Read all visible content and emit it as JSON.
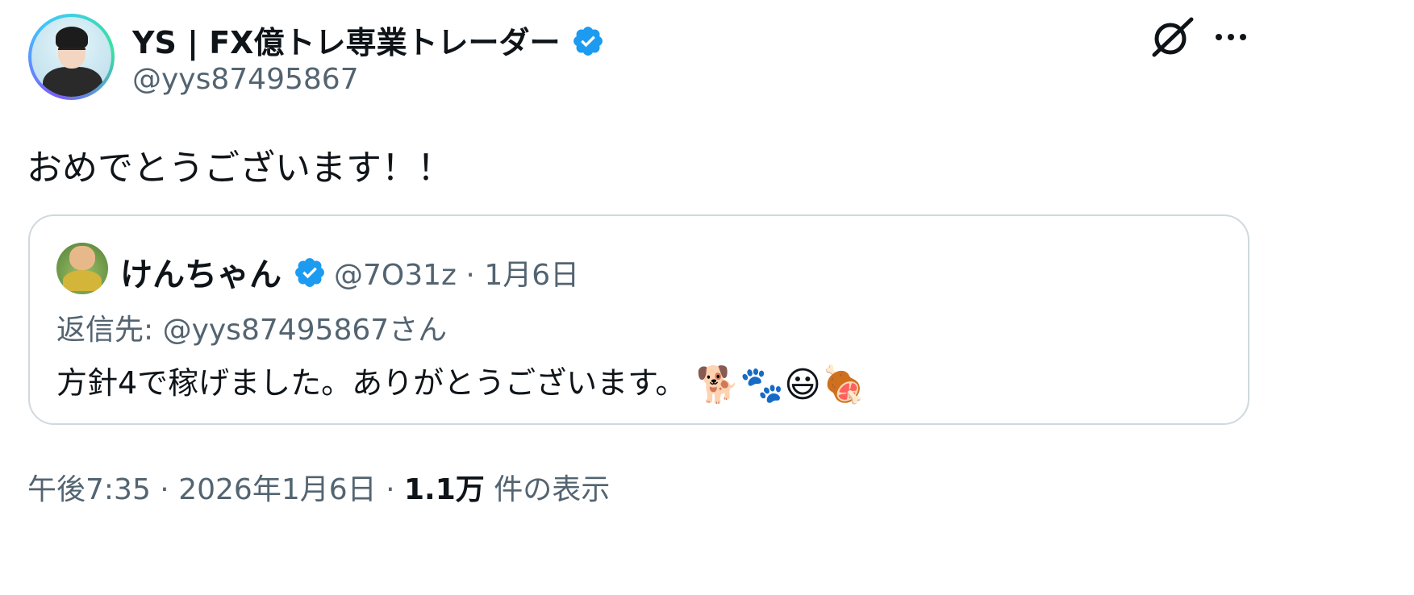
{
  "author": {
    "display_name": "YS | FX億トレ専業トレーダー",
    "handle": "@yys87495867",
    "verified": true,
    "avatar_icon": "profile-avatar"
  },
  "icons": {
    "verified": "verified-badge-icon",
    "grok": "grok-icon",
    "more": "more-options-icon"
  },
  "tweet": {
    "text": "おめでとうございます！！"
  },
  "quote": {
    "display_name": "けんちゃん",
    "verified": true,
    "handle": "@7O31z",
    "separator": "·",
    "date": "1月6日",
    "reply_to": "返信先: @yys87495867さん",
    "text": "方針4で稼げました。ありがとうございます。",
    "emojis": [
      "🐕",
      "🐾",
      "😃",
      "🍖"
    ]
  },
  "meta": {
    "time": "午後7:35",
    "separator": "·",
    "date": "2026年1月6日",
    "views_count": "1.1万",
    "views_label": "件の表示"
  },
  "colors": {
    "text_primary": "#0f1419",
    "text_secondary": "#536471",
    "verified_blue": "#1d9bf0",
    "border": "#cfd9de"
  }
}
